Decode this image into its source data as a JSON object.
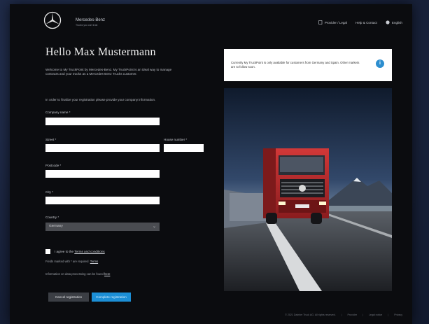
{
  "header": {
    "brand_name": "Mercedes-Benz",
    "brand_tagline": "Trucks you can trust",
    "nav": [
      {
        "label": "Provider / Legal",
        "icon": "document-icon"
      },
      {
        "label": "Help & Contact",
        "icon": "none"
      },
      {
        "label": "English",
        "icon": "globe-icon"
      }
    ]
  },
  "page": {
    "title": "Hello Max Mustermann",
    "intro": "Welcome to My TruckPoint by Mercedes-Benz. My TruckPoint is an ideal way to manage contracts and your trucks as a Mercedes-Benz Trucks customer.",
    "instruction": "In order to finalize your registration please provide your company information."
  },
  "form": {
    "company_name_label": "Company name *",
    "company_name_value": "",
    "street_label": "Street *",
    "street_value": "",
    "house_number_label": "House number *",
    "house_number_value": "",
    "postcode_label": "Postcode *",
    "postcode_value": "",
    "city_label": "City *",
    "city_value": "",
    "country_label": "Country *",
    "country_value": "Germany",
    "terms_prefix": "I agree to the ",
    "terms_link": "Terms and conditions",
    "required_note_prefix": "Fields marked with * are required. ",
    "required_note_link": "Terms",
    "privacy_prefix": "Information on data processing can be found ",
    "privacy_link": "here",
    "cancel_label": "Cancel registration",
    "submit_label": "Complete registration"
  },
  "notice": {
    "text": "Currently My TruckPoint is only available for customers from Germany and Spain. Other markets are to follow soon.",
    "icon": "info-icon"
  },
  "footer": {
    "copyright": "© 2021 Daimler Truck AG. All rights reserved.",
    "links": [
      "Provider",
      "Legal notice",
      "Privacy"
    ]
  },
  "colors": {
    "accent": "#1c8fd6",
    "page_bg": "#0b0c0f",
    "truck_red": "#b8282a"
  }
}
